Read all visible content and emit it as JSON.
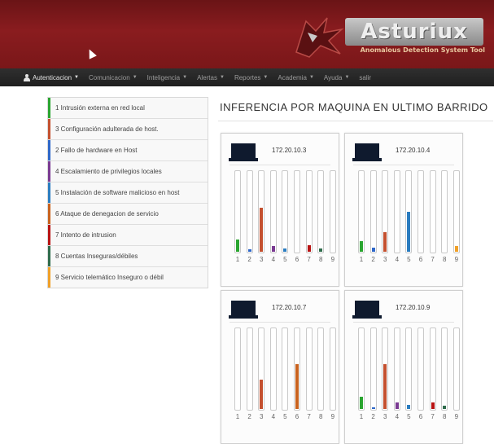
{
  "logo": {
    "title": "Asturiux",
    "subtitle": "Anomalous Detection System Tool"
  },
  "nav": [
    {
      "label": "Autenticacion",
      "dropdown": true
    },
    {
      "label": "Comunicacion",
      "dropdown": true
    },
    {
      "label": "Inteligencia",
      "dropdown": true
    },
    {
      "label": "Alertas",
      "dropdown": true
    },
    {
      "label": "Reportes",
      "dropdown": true
    },
    {
      "label": "Academia",
      "dropdown": true
    },
    {
      "label": "Ayuda",
      "dropdown": true
    },
    {
      "label": "salir",
      "dropdown": false
    }
  ],
  "legend": [
    {
      "label": "1 Intrusión externa en red local",
      "color": "#2aa530"
    },
    {
      "label": "3 Configuración adulterada de host.",
      "color": "#c4502f"
    },
    {
      "label": "2 Fallo de hardware en Host",
      "color": "#2e67c9"
    },
    {
      "label": "4 Escalamiento de privilegios locales",
      "color": "#7a3a92"
    },
    {
      "label": "5 Instalación de software malicioso en host",
      "color": "#2b7dc0"
    },
    {
      "label": "6 Ataque de denegacion de servicio",
      "color": "#c9621e"
    },
    {
      "label": "7 Intento de intrusion",
      "color": "#b81313"
    },
    {
      "label": "8 Cuentas Inseguras/débiles",
      "color": "#2f6c4c"
    },
    {
      "label": "9 Servicio telemático Inseguro o débil",
      "color": "#f0a028"
    }
  ],
  "page_title": "INFERENCIA POR MAQUINA EN ULTIMO BARRIDO",
  "chart_data": [
    {
      "type": "bar",
      "title": "172.20.10.3",
      "categories": [
        "1",
        "2",
        "3",
        "4",
        "5",
        "6",
        "7",
        "8",
        "9"
      ],
      "values": [
        0.15,
        0.03,
        0.55,
        0.07,
        0.04,
        0.0,
        0.08,
        0.04,
        0.0
      ],
      "ylim": [
        0,
        1
      ]
    },
    {
      "type": "bar",
      "title": "172.20.10.4",
      "categories": [
        "1",
        "2",
        "3",
        "4",
        "5",
        "6",
        "7",
        "8",
        "9"
      ],
      "values": [
        0.13,
        0.05,
        0.24,
        0.0,
        0.5,
        0.0,
        0.0,
        0.0,
        0.07
      ],
      "ylim": [
        0,
        1
      ]
    },
    {
      "type": "bar",
      "title": "172.20.10.7",
      "categories": [
        "1",
        "2",
        "3",
        "4",
        "5",
        "6",
        "7",
        "8",
        "9"
      ],
      "values": [
        0.0,
        0.0,
        0.37,
        0.0,
        0.0,
        0.56,
        0.0,
        0.0,
        0.0
      ],
      "ylim": [
        0,
        1
      ]
    },
    {
      "type": "bar",
      "title": "172.20.10.9",
      "categories": [
        "1",
        "2",
        "3",
        "4",
        "5",
        "6",
        "7",
        "8",
        "9"
      ],
      "values": [
        0.15,
        0.02,
        0.56,
        0.08,
        0.05,
        0.0,
        0.08,
        0.04,
        0.0
      ],
      "ylim": [
        0,
        1
      ]
    }
  ]
}
